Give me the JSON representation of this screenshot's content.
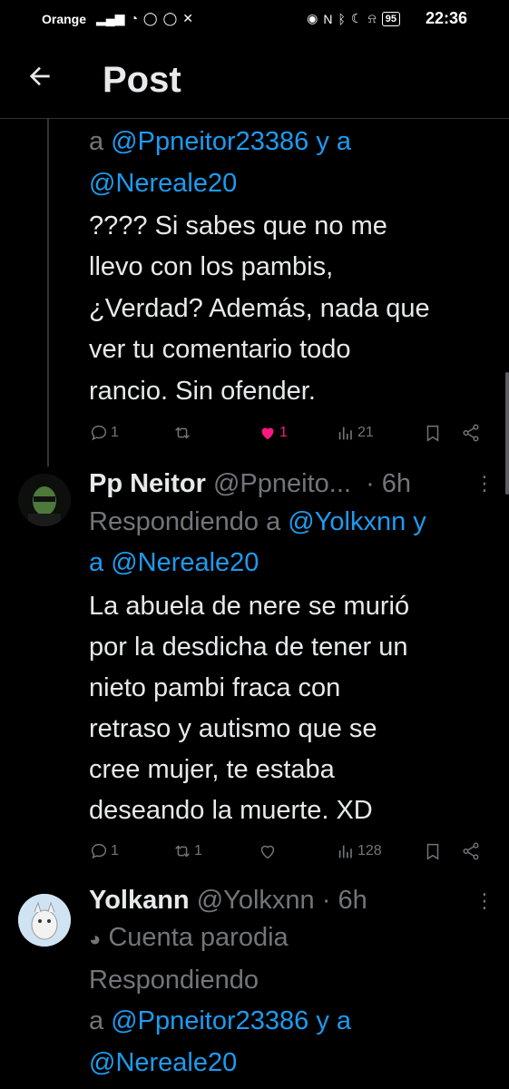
{
  "status_bar": {
    "carrier": "Orange",
    "time": "22:36",
    "battery": "95"
  },
  "header": {
    "title": "Post"
  },
  "post1": {
    "reply_line_a": "a ",
    "reply_mention_1": "@Ppneitor23386",
    "reply_y_a": " y a",
    "reply_mention_2": "@Nereale20",
    "body_lines": [
      "???? Si sabes que no me",
      "llevo con los pambis,",
      "¿Verdad? Además, nada que",
      "ver tu comentario todo",
      "rancio. Sin ofender."
    ],
    "replies": "1",
    "likes": "1",
    "views": "21"
  },
  "post2": {
    "name": "Pp Neitor",
    "handle": "@Ppneito...",
    "time": "· 6h",
    "replying_to": "Respondiendo a",
    "mention_1": "@Yolkxnn",
    "y_a": " y",
    "a": "a ",
    "mention_2": "@Nereale20",
    "body_lines": [
      "La abuela de nere se murió",
      "por la desdicha de tener un",
      "nieto pambi fraca con",
      "retraso y autismo que se",
      "cree mujer, te estaba",
      "deseando la muerte. XD"
    ],
    "replies": "1",
    "reposts": "1",
    "views": "128"
  },
  "post3": {
    "name": "Yolkann",
    "handle": "@Yolkxnn",
    "time": "· 6h",
    "parody": "Cuenta parodia",
    "replying_to": "Respondiendo",
    "a": "a ",
    "mention_1": "@Ppneitor23386",
    "y_a": " y a",
    "mention_2": "@Nereale20"
  },
  "colors": {
    "accent": "#1d9bf0",
    "like": "#f91880",
    "muted": "#71767b"
  }
}
